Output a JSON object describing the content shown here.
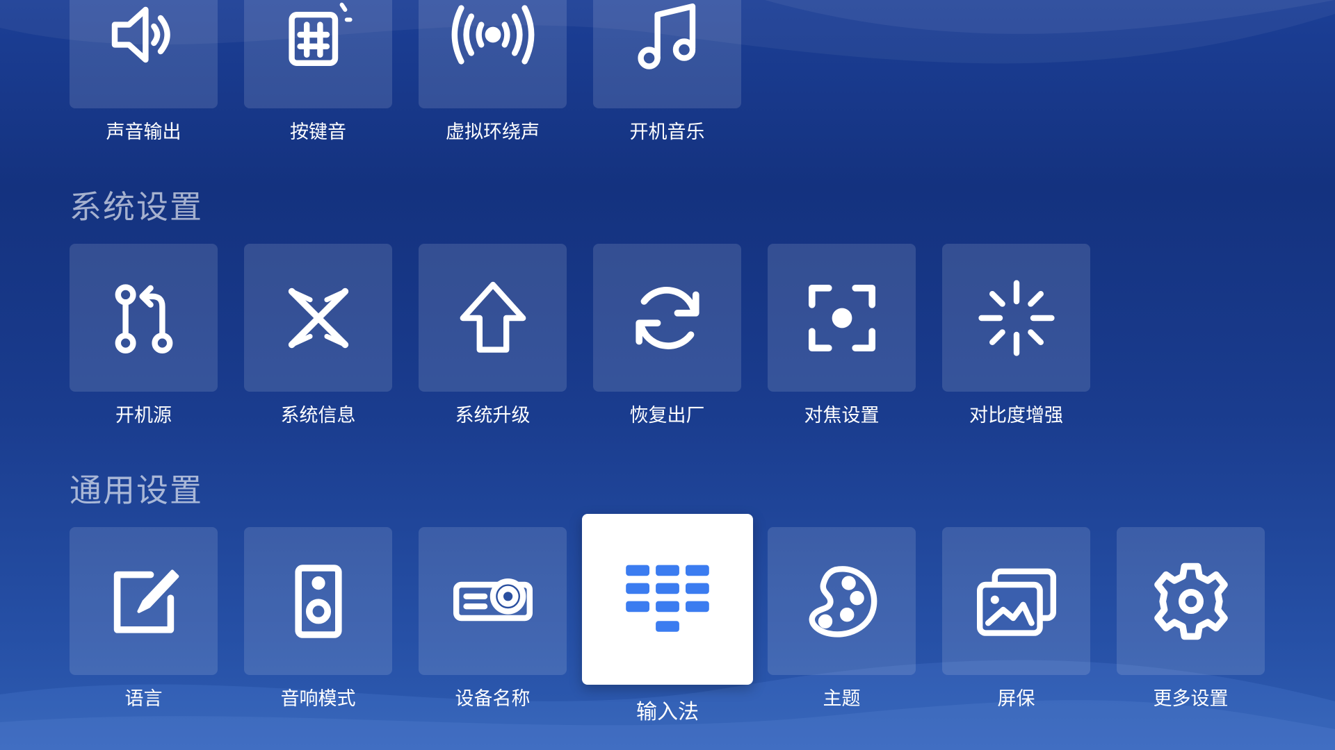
{
  "sections": {
    "sound": {
      "items": [
        {
          "label": "声音输出",
          "icon": "speaker-icon"
        },
        {
          "label": "按键音",
          "icon": "keypad-sound-icon"
        },
        {
          "label": "虚拟环绕声",
          "icon": "surround-sound-icon"
        },
        {
          "label": "开机音乐",
          "icon": "music-note-icon"
        }
      ]
    },
    "system": {
      "title": "系统设置",
      "items": [
        {
          "label": "开机源",
          "icon": "boot-source-icon"
        },
        {
          "label": "系统信息",
          "icon": "system-info-icon"
        },
        {
          "label": "系统升级",
          "icon": "upgrade-arrow-icon"
        },
        {
          "label": "恢复出厂",
          "icon": "factory-reset-icon"
        },
        {
          "label": "对焦设置",
          "icon": "focus-icon"
        },
        {
          "label": "对比度增强",
          "icon": "contrast-enhance-icon"
        }
      ]
    },
    "general": {
      "title": "通用设置",
      "items": [
        {
          "label": "语言",
          "icon": "edit-language-icon"
        },
        {
          "label": "音响模式",
          "icon": "speaker-box-icon"
        },
        {
          "label": "设备名称",
          "icon": "projector-icon"
        },
        {
          "label": "输入法",
          "icon": "keyboard-icon",
          "focused": true
        },
        {
          "label": "主题",
          "icon": "palette-icon"
        },
        {
          "label": "屏保",
          "icon": "screensaver-icon"
        },
        {
          "label": "更多设置",
          "icon": "gear-icon"
        }
      ]
    }
  },
  "colors": {
    "background_top": "#14327f",
    "background_bottom": "#2f5db2",
    "focus_tile": "#ffffff",
    "focus_icon": "#3b7cf0"
  }
}
